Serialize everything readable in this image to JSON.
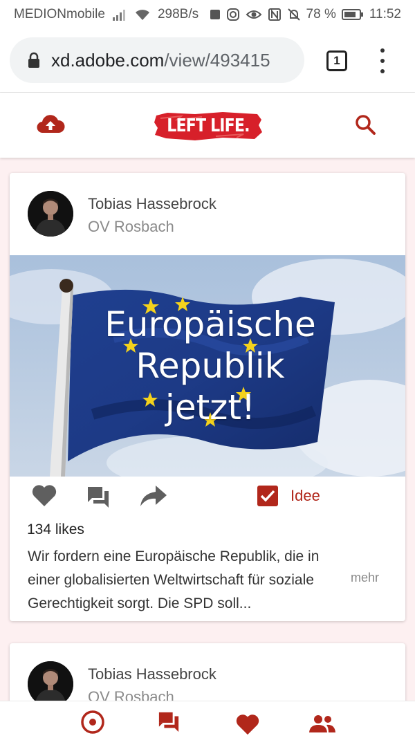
{
  "status_bar": {
    "carrier": "MEDIONmobile",
    "speed": "298B/s",
    "battery": "78 %",
    "time": "11:52"
  },
  "browser": {
    "url_host": "xd.adobe.com",
    "url_path": "/view/493415",
    "tab_count": "1"
  },
  "app": {
    "logo_text": "LEFT LIFE.",
    "brand_color": "#b1271b"
  },
  "posts": [
    {
      "author": "Tobias Hassebrock",
      "group": "OV Rosbach",
      "image_text_lines": [
        "Europäische",
        "Republik",
        "jetzt!"
      ],
      "likes": "134 likes",
      "tag": "Idee",
      "description": "Wir fordern eine Europäische Republik, die in einer globalisierten Weltwirtschaft für soziale Gerechtigkeit sorgt. Die SPD soll...",
      "more": "mehr"
    },
    {
      "author": "Tobias Hassebrock",
      "group": "OV Rosbach"
    }
  ],
  "bottom_nav": [
    "location-icon",
    "forum-icon",
    "heart-icon",
    "people-icon"
  ]
}
